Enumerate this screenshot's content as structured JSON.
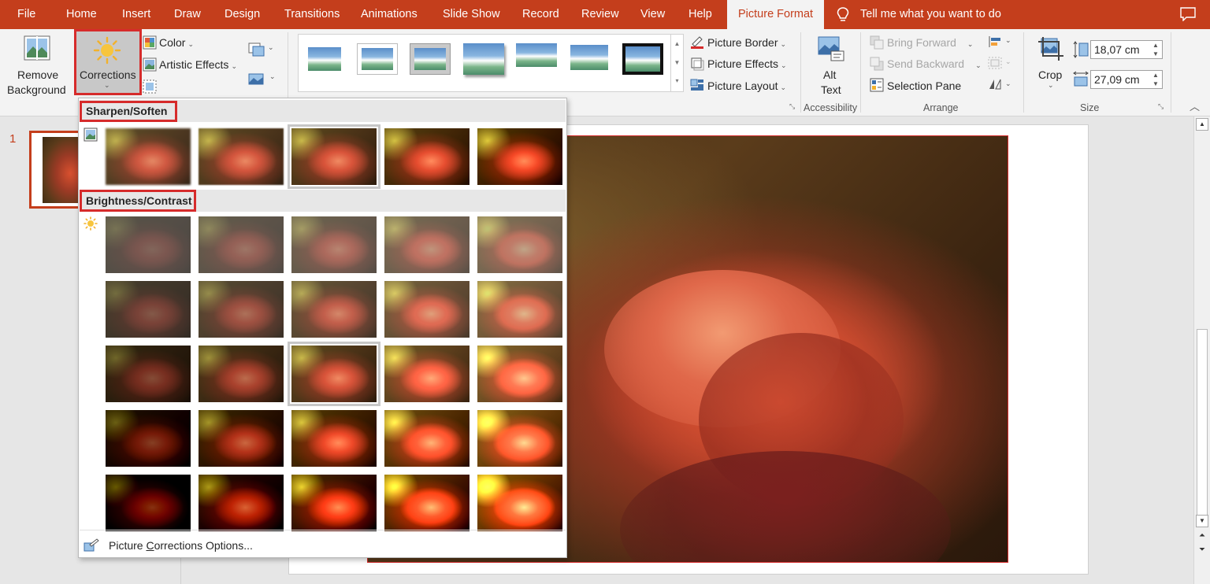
{
  "tabs": [
    "File",
    "Home",
    "Insert",
    "Draw",
    "Design",
    "Transitions",
    "Animations",
    "Slide Show",
    "Record",
    "Review",
    "View",
    "Help",
    "Picture Format"
  ],
  "active_tab": "Picture Format",
  "tell_me": "Tell me what you want to do",
  "ribbon": {
    "remove_bg": [
      "Remove",
      "Background"
    ],
    "corrections": "Corrections",
    "color": "Color",
    "artistic": "Artistic Effects",
    "picture_border": "Picture Border",
    "picture_effects": "Picture Effects",
    "picture_layout": "Picture Layout",
    "alt_text": [
      "Alt",
      "Text"
    ],
    "accessibility": "Accessibility",
    "bring_forward": "Bring Forward",
    "send_backward": "Send Backward",
    "selection_pane": "Selection Pane",
    "arrange": "Arrange",
    "crop": "Crop",
    "height": "18,07 cm",
    "width": "27,09 cm",
    "size": "Size"
  },
  "slide_number": "1",
  "dropdown": {
    "sharpen_header": "Sharpen/Soften",
    "brightness_header": "Brightness/Contrast",
    "options_pre": "Picture ",
    "options_u": "C",
    "options_post": "orrections Options...",
    "sharpen_count": 5,
    "sharpen_selected": 2,
    "brightness_rows": 5,
    "brightness_cols": 5,
    "brightness_selected": [
      2,
      2
    ]
  },
  "colors": {
    "accent": "#c43e1c",
    "highlight": "#d62b2b"
  }
}
